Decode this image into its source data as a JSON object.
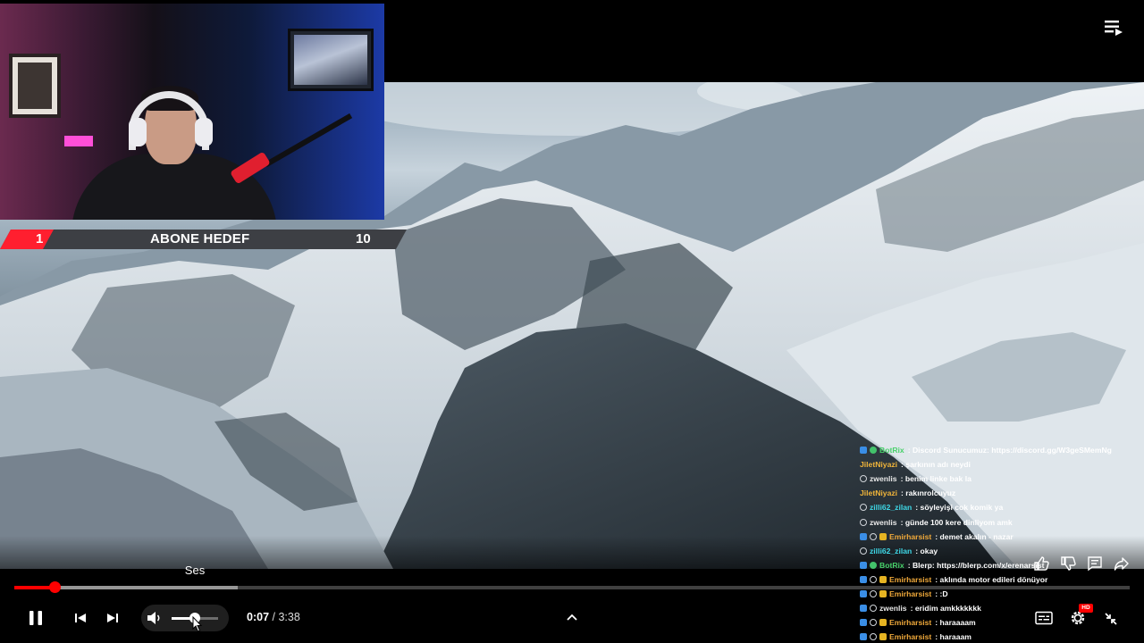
{
  "goal": {
    "current": "1",
    "title": "ABONE HEDEF",
    "target": "10"
  },
  "chat": [
    {
      "badges": [
        "blue",
        "green"
      ],
      "name": "BotRix",
      "name_color": "#48d16a",
      "message": ": Discord Sunucumuz: https://discord.gg/W3geSMemNg"
    },
    {
      "badges": [],
      "name": "JiletNiyazi",
      "name_color": "#f0b43a",
      "message": ": şarkının adı neydi"
    },
    {
      "badges": [
        "ring"
      ],
      "name": "zwenlis",
      "name_color": "#e7e7e7",
      "message": ": benim linke bak la"
    },
    {
      "badges": [],
      "name": "JiletNiyazi",
      "name_color": "#f0b43a",
      "message": ": rakınrolcuyuz"
    },
    {
      "badges": [
        "ring"
      ],
      "name": "zilli62_zilan",
      "name_color": "#3ed7e6",
      "message": ": söyleyişi cok komik ya"
    },
    {
      "badges": [
        "ring"
      ],
      "name": "zwenlis",
      "name_color": "#e7e7e7",
      "message": ": günde 100 kere dinliyom amk"
    },
    {
      "badges": [
        "blue",
        "ring",
        "gold"
      ],
      "name": "Emirharsist",
      "name_color": "#f0a93a",
      "message": ": demet akalın - nazar"
    },
    {
      "badges": [
        "ring"
      ],
      "name": "zilli62_zilan",
      "name_color": "#3ed7e6",
      "message": ": okay"
    },
    {
      "badges": [
        "blue",
        "green"
      ],
      "name": "BotRix",
      "name_color": "#48d16a",
      "message": ": Blerp: https://blerp.com/x/erenarsist"
    },
    {
      "badges": [
        "blue",
        "ring",
        "gold"
      ],
      "name": "Emirharsist",
      "name_color": "#f0a93a",
      "message": ": aklında motor edileri dönüyor"
    },
    {
      "badges": [
        "blue",
        "ring",
        "gold"
      ],
      "name": "Emirharsist",
      "name_color": "#f0a93a",
      "message": ": :D"
    },
    {
      "badges": [
        "blue",
        "ring"
      ],
      "name": "zwenlis",
      "name_color": "#e7e7e7",
      "message": ": eridim amkkkkkkk"
    },
    {
      "badges": [
        "blue",
        "ring",
        "gold"
      ],
      "name": "Emirharsist",
      "name_color": "#f0a93a",
      "message": ": haraaaam"
    },
    {
      "badges": [
        "blue",
        "ring",
        "gold"
      ],
      "name": "Emirharsist",
      "name_color": "#f0a93a",
      "message": ": haraaam"
    }
  ],
  "player": {
    "tooltip": "Ses",
    "time_current": "0:07",
    "time_separator": " / ",
    "time_duration": "3:38",
    "progress_played": 0.036,
    "progress_buffered": 0.2,
    "volume_level": 0.5,
    "quality_badge": "HD",
    "accent_color": "#ff0000"
  },
  "icons": {
    "playlist": "playlist-icon",
    "pause": "pause-icon",
    "previous": "previous-icon",
    "next": "next-icon",
    "volume": "volume-icon",
    "chevron": "chevron-up-icon",
    "captions": "captions-icon",
    "settings": "settings-icon",
    "exit_fullscreen": "exit-fullscreen-icon",
    "like": "like-icon",
    "dislike": "dislike-icon",
    "comment": "comment-icon",
    "share": "share-icon"
  }
}
